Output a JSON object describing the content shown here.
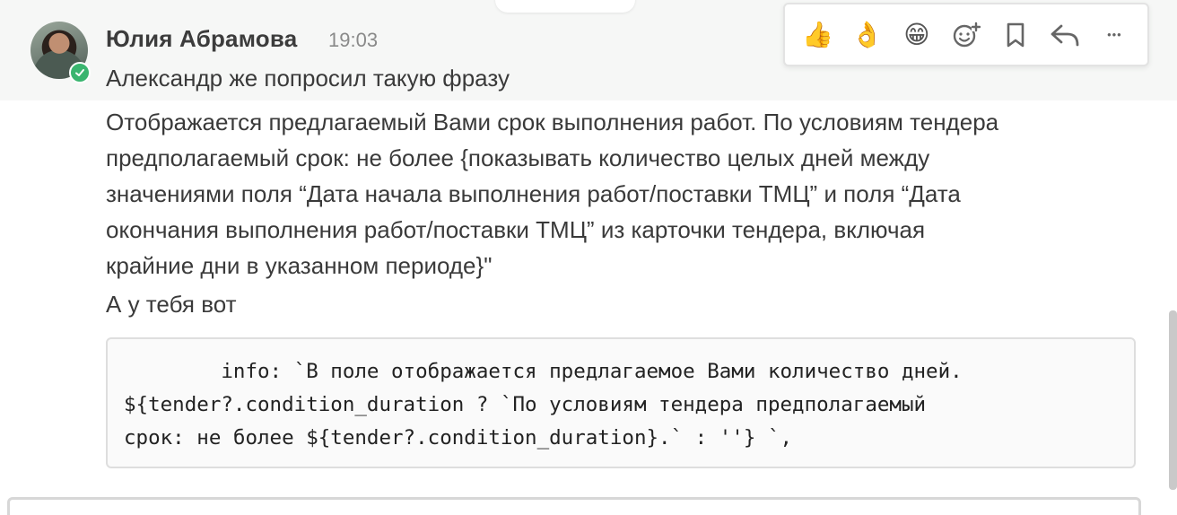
{
  "message": {
    "author": "Юлия Абрамова",
    "time": "19:03",
    "line1": "Александр же попросил такую фразу",
    "paragraph": [
      "Отображается предлагаемый Вами срок выполнения работ. По условиям тендера",
      "предполагаемый срок: не более {показывать количество целых дней между",
      "значениями поля “Дата начала выполнения работ/поставки ТМЦ” и поля “Дата",
      "окончания выполнения работ/поставки ТМЦ” из карточки тендера, включая",
      "крайние дни в указанном периоде}\""
    ],
    "line3": "А у тебя вот",
    "code": [
      "        info: `В поле отображается предлагаемое Вами количество дней.",
      "${tender?.condition_duration ? `По условиям тендера предполагаемый",
      "срок: не более ${tender?.condition_duration}.` : ''} `,"
    ]
  },
  "reaction_bar": {
    "items": [
      {
        "name": "thumbs-up-reaction",
        "glyph": "👍"
      },
      {
        "name": "ok-hand-reaction",
        "glyph": "👌"
      },
      {
        "name": "grin-reaction",
        "glyph": "😁"
      },
      {
        "name": "add-reaction-icon",
        "glyph": ""
      },
      {
        "name": "bookmark-icon",
        "glyph": ""
      },
      {
        "name": "reply-icon",
        "glyph": ""
      },
      {
        "name": "more-icon",
        "glyph": "•••"
      }
    ]
  },
  "colors": {
    "online": "#3ab56f",
    "hover_band": "#f6f7f6"
  }
}
